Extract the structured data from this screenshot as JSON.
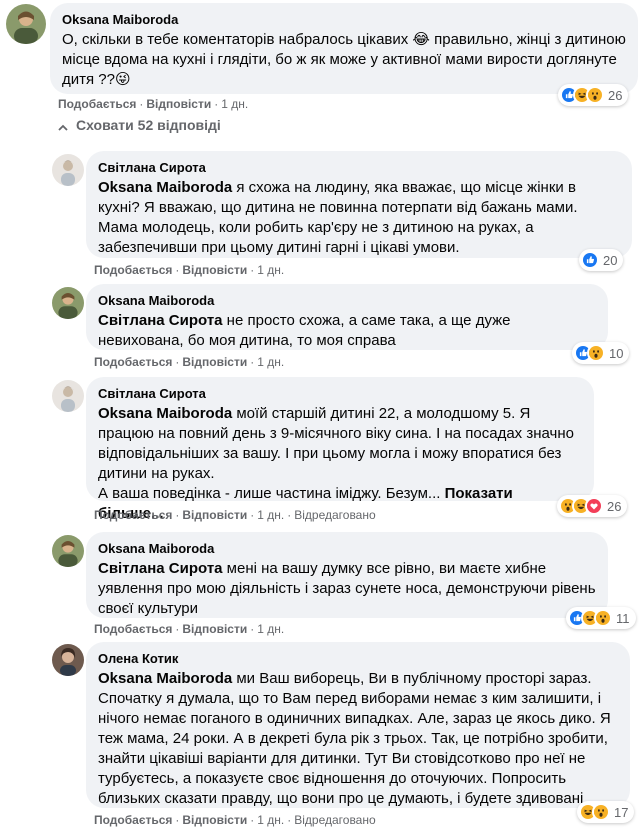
{
  "top_comment": {
    "author": "Oksana Maiboroda",
    "text": "О, скільки в тебе коментаторів набралось цікавих 😂 правильно, жінці з дитиною місце вдома на кухні і глядіти, бо ж як може у активної мами вирости доглянуте дитя ??😜",
    "like": "Подобається",
    "reply": "Відповісти",
    "time": "1 дн.",
    "reactions": [
      "like",
      "haha",
      "wow"
    ],
    "reaction_count": "26"
  },
  "hide_replies_label": "Сховати 52 відповіді",
  "replies": [
    {
      "author": "Світлана Сирота",
      "mention": "Oksana Maiboroda",
      "text": " я схожа на людину, яка вважає, що місце жінки в кухні? Я вважаю, що дитина не повинна потерпати від бажань мами. Мама молодець, коли робить кар'єру не з дитиною на руках, а забезпечивши при цьому дитині гарні і цікаві умови.",
      "like": "Подобається",
      "reply": "Відповісти",
      "time": "1 дн.",
      "reactions": [
        "like"
      ],
      "reaction_count": "20"
    },
    {
      "author": "Oksana Maiboroda",
      "mention": "Світлана Сирота",
      "text": " не просто схожа, а саме така, а ще дуже невихована, бо моя дитина, то моя справа",
      "like": "Подобається",
      "reply": "Відповісти",
      "time": "1 дн.",
      "reactions": [
        "like",
        "wow"
      ],
      "reaction_count": "10"
    },
    {
      "author": "Світлана Сирота",
      "mention": "Oksana Maiboroda",
      "text": " моїй старшій дитині 22, а молодшому 5. Я працюю на повний день з 9-місячного віку сина. І на посадах значно відповідальніших за вашу. І при цьому могла і можу впоратися без дитини на руках.",
      "text2": "А ваша поведінка - лише частина іміджу. Безум...",
      "see_more": "Показати більше...",
      "like": "Подобається",
      "reply": "Відповісти",
      "time": "1 дн.",
      "edited": "Відредаговано",
      "reactions": [
        "wow",
        "haha",
        "love"
      ],
      "reaction_count": "26"
    },
    {
      "author": "Oksana Maiboroda",
      "mention": "Світлана Сирота",
      "text": " мені на вашу думку все рівно, ви маєте хибне уявлення про мою діяльність і зараз сунете носа, демонструючи рівень своєї культури",
      "like": "Подобається",
      "reply": "Відповісти",
      "time": "1 дн.",
      "reactions": [
        "like",
        "haha",
        "wow"
      ],
      "reaction_count": "11"
    },
    {
      "author": "Олена Котик",
      "mention": "Oksana Maiboroda",
      "text": " ми Ваш виборець, Ви в публічному просторі зараз. Спочатку я думала, що то Вам перед виборами немає з ким залишити, і нічого немає поганого в одиничних випадках. Але, зараз це якось дико. Я теж мама, 24 роки. А в декреті була рік з трьох. Так, це потрібно зробити, знайти цікавіші варіанти для дитинки. Тут Ви стовідсотково про неї не турбуєтесь, а показуєте своє відношення до оточуючих. Попросить близьких сказати правду, що вони про це думають, і будете здивовані",
      "like": "Подобається",
      "reply": "Відповісти",
      "time": "1 дн.",
      "edited": "Відредаговано",
      "reactions": [
        "haha",
        "wow"
      ],
      "reaction_count": "17"
    }
  ],
  "colors": {
    "bubble": "#f0f2f5",
    "secondary_text": "#65676b",
    "like_blue": "#1877f2",
    "love_red": "#f33e58",
    "emoji_yellow": "#f7b125"
  }
}
